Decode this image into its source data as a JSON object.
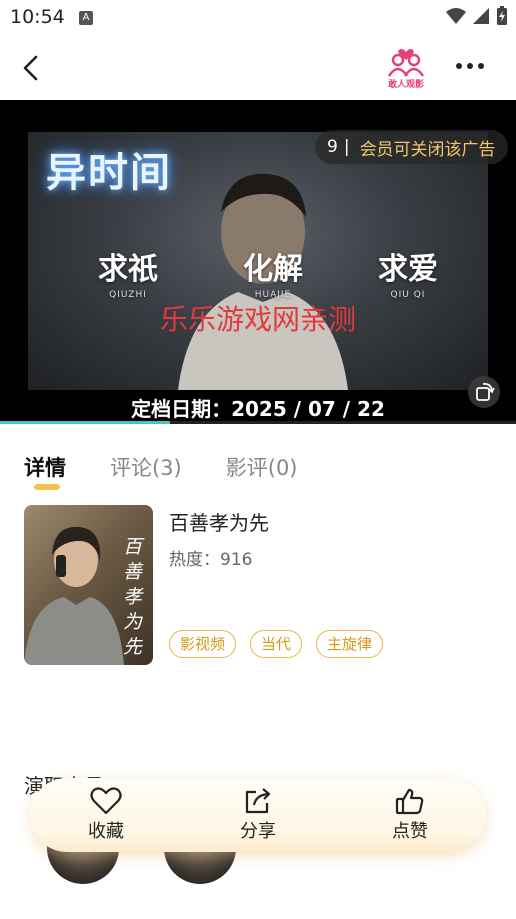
{
  "status_bar": {
    "time": "10:54",
    "a_badge": "A"
  },
  "header": {
    "logo_text": "敢人观影",
    "back_icon": "chevron-left-icon",
    "more_icon": "more-dots-icon"
  },
  "video": {
    "title_art": "异时间",
    "words": [
      {
        "text": "求祇",
        "pinyin": "QIUZHI"
      },
      {
        "text": "化解",
        "pinyin": "HUAJIE"
      },
      {
        "text": "求爱",
        "pinyin": "QIU QI"
      }
    ],
    "watermark": "乐乐游戏网亲测",
    "ad_countdown": "9",
    "ad_separator": "|",
    "ad_text": "会员可关闭该广告",
    "release_label": "定档日期：2025 / 07 / 22",
    "progress_percent": 33
  },
  "tabs": [
    {
      "label": "详情",
      "active": true
    },
    {
      "label": "评论(3)",
      "active": false
    },
    {
      "label": "影评(0)",
      "active": false
    }
  ],
  "detail": {
    "title": "百善孝为先",
    "heat": "热度：916",
    "poster_text": "百善孝为先",
    "tags": [
      "影视频",
      "当代",
      "主旋律"
    ]
  },
  "cast": {
    "title": "演职人员"
  },
  "actions": [
    {
      "label": "收藏",
      "icon": "heart-icon"
    },
    {
      "label": "分享",
      "icon": "share-icon"
    },
    {
      "label": "点赞",
      "icon": "thumbs-up-icon"
    }
  ],
  "colors": {
    "accent": "#f3c24c",
    "tag_border": "#e7b84a",
    "tag_text": "#d79b1c",
    "watermark": "#e23a3a",
    "ad_text": "#f2c66b",
    "progress": "#3ec9c9"
  }
}
